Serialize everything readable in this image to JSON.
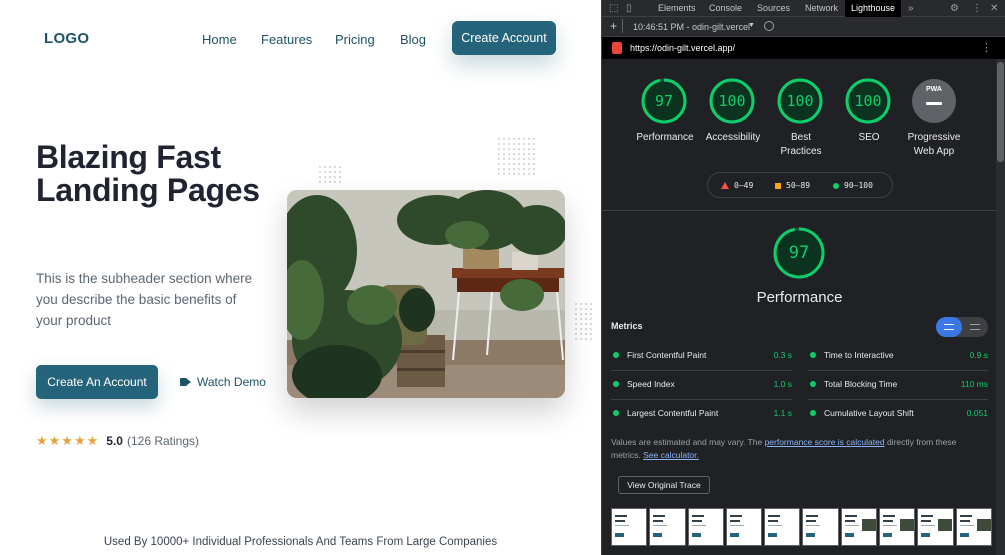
{
  "site": {
    "logo": "LOGO",
    "nav": [
      "Home",
      "Features",
      "Pricing",
      "Blog"
    ],
    "cta_top": "Create Account",
    "hero_title": "Blazing Fast Landing Pages",
    "hero_sub": "This is the subheader section where you describe the basic benefits of your product",
    "cta_main": "Create An Account",
    "watch_demo": "Watch Demo",
    "stars": "★★★★★",
    "rating_score": "5.0",
    "rating_count": "(126 Ratings)",
    "used_by": "Used By 10000+ Individual Professionals And Teams From Large Companies",
    "colors": {
      "brand": "#25637a",
      "text": "#1f2430",
      "star": "#e6a23c"
    }
  },
  "devtools": {
    "tabs": [
      "Elements",
      "Console",
      "Sources",
      "Network",
      "Lighthouse"
    ],
    "active_tab": "Lighthouse",
    "more_tabs": "»",
    "report_selector": "10:46:51 PM - odin-gilt.vercel",
    "url": "https://odin-gilt.vercel.app/",
    "scores": [
      {
        "value": "97",
        "label": "Performance",
        "fill": 0.97
      },
      {
        "value": "100",
        "label": "Accessibility",
        "fill": 1.0
      },
      {
        "value": "100",
        "label": "Best Practices",
        "fill": 1.0
      },
      {
        "value": "100",
        "label": "SEO",
        "fill": 1.0
      }
    ],
    "pwa": {
      "badge": "PWA",
      "label": "Progressive Web App"
    },
    "legend": [
      "0–49",
      "50–89",
      "90–100"
    ],
    "performance_score": "97",
    "performance_title": "Performance",
    "metrics_heading": "Metrics",
    "metrics": [
      {
        "name": "First Contentful Paint",
        "value": "0.3 s"
      },
      {
        "name": "Time to Interactive",
        "value": "0.9 s"
      },
      {
        "name": "Speed Index",
        "value": "1.0 s"
      },
      {
        "name": "Total Blocking Time",
        "value": "110 ms"
      },
      {
        "name": "Largest Contentful Paint",
        "value": "1.1 s"
      },
      {
        "name": "Cumulative Layout Shift",
        "value": "0.051"
      }
    ],
    "note_prefix": "Values are estimated and may vary. The ",
    "note_link1": "performance score is calculated",
    "note_mid": " directly from these metrics. ",
    "note_link2": "See calculator.",
    "trace_button": "View Original Trace",
    "colors": {
      "pass": "#0cce6b",
      "average": "#ffa400",
      "fail": "#ff4e42",
      "bg": "#202124"
    }
  }
}
